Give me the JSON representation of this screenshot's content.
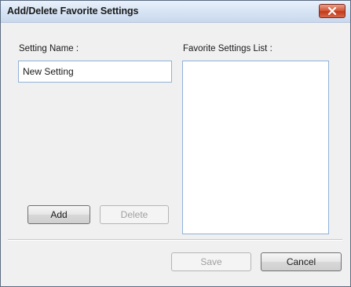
{
  "window": {
    "title": "Add/Delete Favorite Settings",
    "close_icon": "close-icon"
  },
  "left_panel": {
    "setting_name_label": "Setting Name :",
    "setting_name_value": "New Setting",
    "add_label": "Add",
    "delete_label": "Delete"
  },
  "right_panel": {
    "favorite_list_label": "Favorite Settings List :",
    "items": []
  },
  "footer": {
    "save_label": "Save",
    "cancel_label": "Cancel"
  },
  "colors": {
    "close_button": "#d65a3c",
    "input_border": "#8fb2da",
    "dialog_background": "#f0f0f0"
  }
}
